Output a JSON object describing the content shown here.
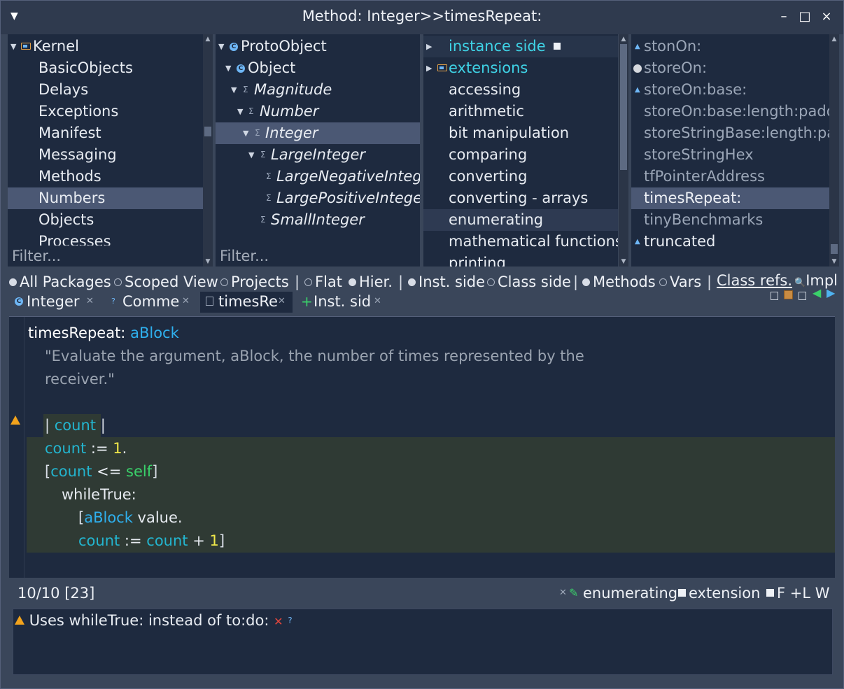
{
  "window": {
    "title": "Method: Integer>>timesRepeat:",
    "buttons": {
      "minimize": "–",
      "maximize": "□",
      "close": "×"
    }
  },
  "packages": {
    "items": [
      "Kernel",
      "BasicObjects",
      "Delays",
      "Exceptions",
      "Manifest",
      "Messaging",
      "Methods",
      "Numbers",
      "Objects",
      "Processes"
    ],
    "selected": "Numbers",
    "filter_placeholder": "Filter..."
  },
  "classes": {
    "items": [
      "ProtoObject",
      "Object",
      "Magnitude",
      "Number",
      "Integer",
      "LargeInteger",
      "LargeNegativeInteger",
      "LargePositiveInteger",
      "SmallInteger"
    ],
    "selected": "Integer",
    "filter_placeholder": "Filter..."
  },
  "protocols": {
    "items": [
      "instance side",
      "extensions",
      "accessing",
      "arithmetic",
      "bit manipulation",
      "comparing",
      "converting",
      "converting - arrays",
      "enumerating",
      "mathematical functions",
      "printing"
    ],
    "selected": "enumerating"
  },
  "methods": {
    "items": [
      "stonOn:",
      "storeOn:",
      "storeOn:base:",
      "storeOn:base:length:padded:",
      "storeStringBase:length:padded:",
      "storeStringHex",
      "tfPointerAddress",
      "timesRepeat:",
      "tinyBenchmarks",
      "truncated"
    ],
    "selected": "timesRepeat:"
  },
  "toolbar": {
    "all_packages": "All Packages",
    "scoped_view": "Scoped View",
    "projects": "Projects",
    "flat": "Flat",
    "hier": "Hier.",
    "inst_side": "Inst. side",
    "class_side": "Class side",
    "methods": "Methods",
    "vars": "Vars",
    "class_refs": "Class refs.",
    "impl": "Impl"
  },
  "tabs": [
    {
      "label": "Integer"
    },
    {
      "label": "Comme"
    },
    {
      "label": "timesRe"
    },
    {
      "label": "Inst. sid"
    }
  ],
  "code": {
    "selector": "timesRepeat:",
    "arg": "aBlock",
    "comment1": "\"Evaluate the argument, aBlock, the number of times represented by the",
    "comment2": "receiver.\"",
    "temp_open": "| ",
    "temp": "count",
    "temp_close": " |",
    "count": "count",
    "assign": " := ",
    "one": "1",
    "dot": ".",
    "lbr": "[",
    "rbr": "]",
    "le": " <= ",
    "self": "self",
    "whileTrue": "whileTrue:",
    "value": " value",
    "plus": " + "
  },
  "status": {
    "position": "10/10 [23]",
    "protocol": "enumerating",
    "extension": "extension",
    "flags": "F +L W"
  },
  "critique": {
    "message": "Uses whileTrue: instead of to:do:",
    "remove": "✕",
    "help": "?"
  }
}
